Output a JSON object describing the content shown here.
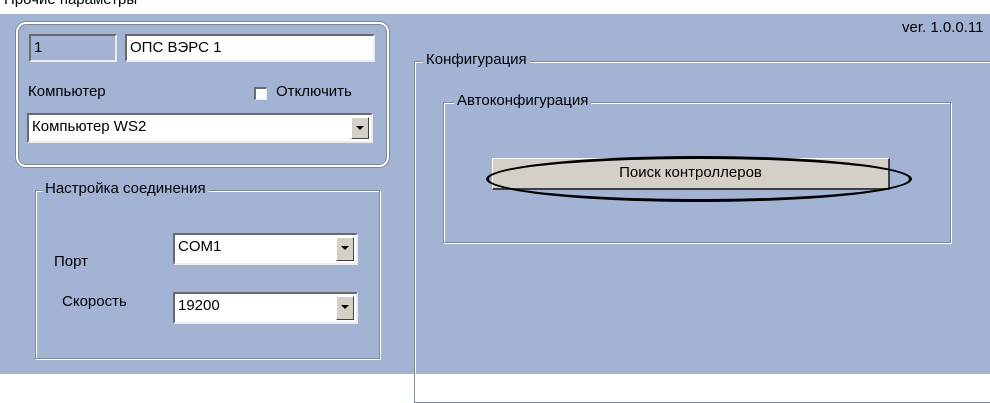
{
  "header": {
    "title_partial": "Прочие параметры"
  },
  "version_label": "ver. 1.0.0.11",
  "object": {
    "id": "1",
    "name": "ОПС ВЭРС 1",
    "computer_label": "Компьютер",
    "disable_label": "Отключить",
    "disable_checked": false,
    "computer_value": "Компьютер WS2"
  },
  "connection": {
    "legend": "Настройка соединения",
    "port_label": "Порт",
    "port_value": "COM1",
    "speed_label": "Скорость",
    "speed_value": "19200"
  },
  "configuration": {
    "legend": "Конфигурация",
    "auto_legend": "Автоконфигурация",
    "search_button": "Поиск контроллеров"
  },
  "colors": {
    "panel_bg": "#a2b3d4",
    "button_bg": "#d4d0c8"
  }
}
